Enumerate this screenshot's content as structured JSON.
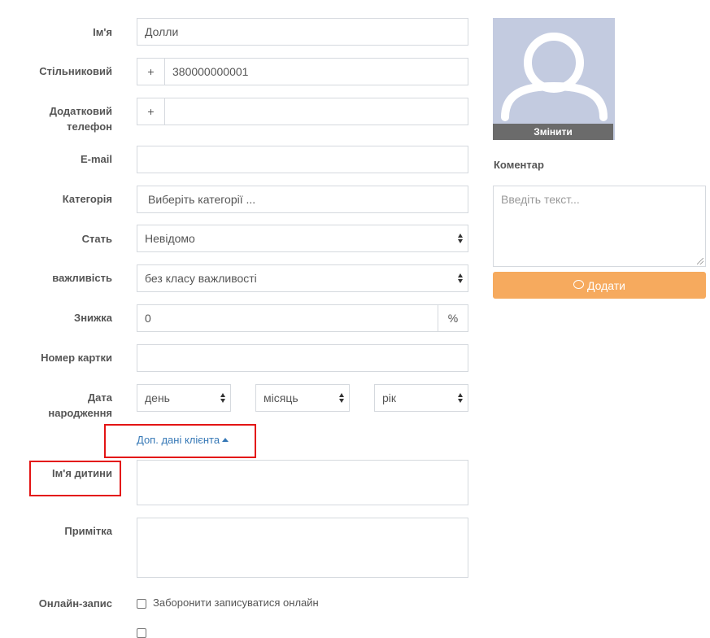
{
  "form": {
    "name": {
      "label": "Ім'я",
      "value": "Долли"
    },
    "mobile": {
      "label": "Стільниковий",
      "prefix": "+",
      "value": "380000000001"
    },
    "extra_phone": {
      "label_line1": "Додатковий",
      "label_line2": "телефон",
      "prefix": "+",
      "value": ""
    },
    "email": {
      "label": "E-mail",
      "value": ""
    },
    "category": {
      "label": "Категорія",
      "placeholder": "Виберіть категорії ..."
    },
    "gender": {
      "label": "Стать",
      "selected": "Невідомо"
    },
    "importance": {
      "label": "важливість",
      "selected": "без класу важливості"
    },
    "discount": {
      "label": "Знижка",
      "value": "0",
      "suffix": "%"
    },
    "card_number": {
      "label": "Номер картки",
      "value": ""
    },
    "birth_date": {
      "label_line1": "Дата",
      "label_line2": "народження",
      "day": "день",
      "month": "місяць",
      "year": "рік"
    },
    "extra_toggle": "Доп. дані клієнта",
    "child_name": {
      "label": "Ім'я дитини",
      "value": ""
    },
    "note": {
      "label": "Примітка",
      "value": ""
    },
    "online_booking": {
      "label": "Онлайн-запис",
      "checkbox_label": "Заборонити записуватися онлайн",
      "checked": false
    }
  },
  "sidebar": {
    "avatar_change": "Змінити",
    "comment_label": "Коментар",
    "comment_placeholder": "Введіть текст...",
    "add_button": "Додати"
  },
  "colors": {
    "accent_orange": "#f6aa5e",
    "link_blue": "#3678b6",
    "highlight_red": "#e31414",
    "avatar_bg": "#c3cbe0"
  }
}
